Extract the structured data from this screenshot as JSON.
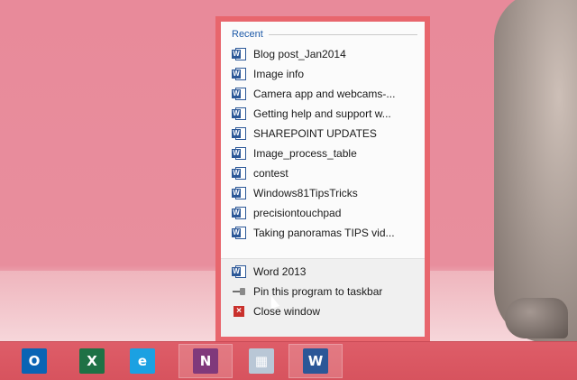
{
  "jumplist": {
    "section_title": "Recent",
    "recent_items": [
      {
        "label": "Blog post_Jan2014"
      },
      {
        "label": "Image info"
      },
      {
        "label": "Camera app and webcams-..."
      },
      {
        "label": "Getting help and support w..."
      },
      {
        "label": "SHAREPOINT UPDATES"
      },
      {
        "label": "Image_process_table"
      },
      {
        "label": "contest"
      },
      {
        "label": "Windows81TipsTricks"
      },
      {
        "label": "precisiontouchpad"
      },
      {
        "label": "Taking panoramas TIPS vid..."
      }
    ],
    "tasks": {
      "program_label": "Word 2013",
      "pin_label": "Pin this program to taskbar",
      "close_label": "Close window"
    }
  },
  "taskbar": {
    "apps": [
      {
        "name": "outlook-icon",
        "glyph": "O",
        "color": "#0a64b4"
      },
      {
        "name": "excel-icon",
        "glyph": "X",
        "color": "#1e7145"
      },
      {
        "name": "internet-explorer-icon",
        "glyph": "e",
        "color": "#1ba1e2"
      },
      {
        "name": "onenote-icon",
        "glyph": "N",
        "color": "#80397b"
      },
      {
        "name": "calculator-icon",
        "glyph": "▦",
        "color": "#b9c7d6"
      },
      {
        "name": "word-icon",
        "glyph": "W",
        "color": "#2b5797"
      }
    ]
  },
  "colors": {
    "jumplist_border": "#e8666d",
    "taskbar": "#da5863",
    "accent_blue": "#1e5aa8"
  }
}
